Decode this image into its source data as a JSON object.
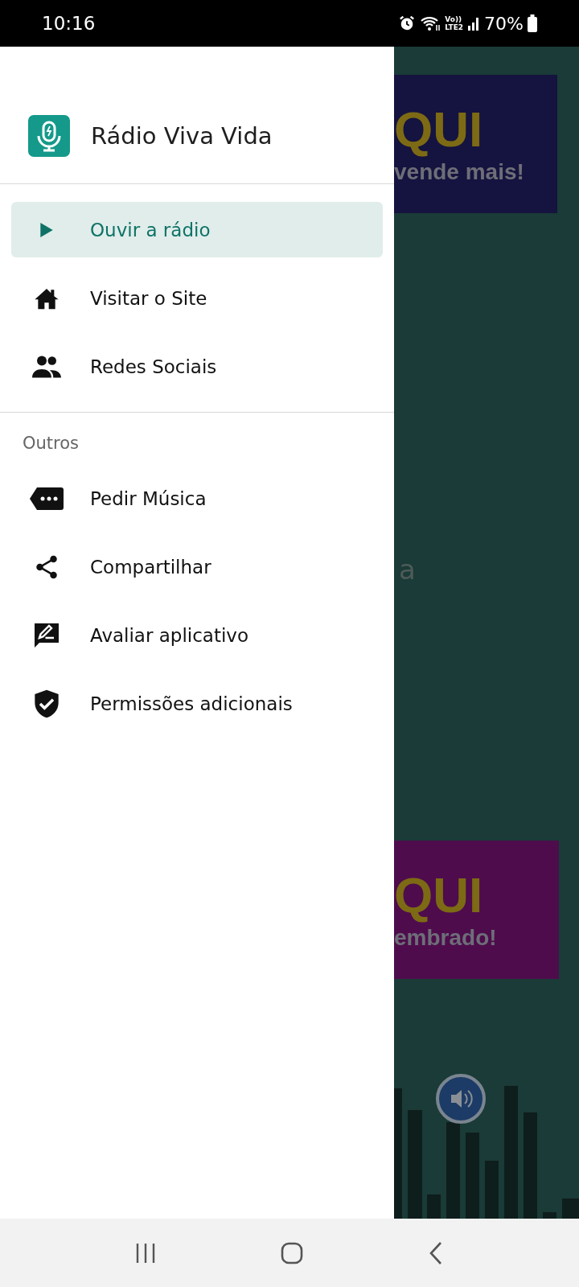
{
  "status_bar": {
    "time": "10:16",
    "network_top": "Vo))",
    "network_bottom": "LTE2",
    "battery": "70%"
  },
  "drawer": {
    "title": "Rádio Viva Vida",
    "primary_items": [
      {
        "label": "Ouvir a rádio",
        "kind": "play",
        "selected": true
      },
      {
        "label": "Visitar o Site",
        "kind": "home",
        "selected": false
      },
      {
        "label": "Redes Sociais",
        "kind": "people",
        "selected": false
      }
    ],
    "section_title": "Outros",
    "secondary_items": [
      {
        "label": "Pedir Música",
        "kind": "message",
        "selected": false
      },
      {
        "label": "Compartilhar",
        "kind": "share",
        "selected": false
      },
      {
        "label": "Avaliar aplicativo",
        "kind": "feedback",
        "selected": false
      },
      {
        "label": "Permissões adicionais",
        "kind": "shield",
        "selected": false
      }
    ]
  },
  "background": {
    "banners": [
      {
        "headline": "QUI",
        "tagline": "vende mais!",
        "color": "#15133f"
      },
      {
        "headline": "QUI",
        "tagline": "embrado!",
        "color": "#4e0c4d"
      }
    ],
    "fragment": "a"
  }
}
